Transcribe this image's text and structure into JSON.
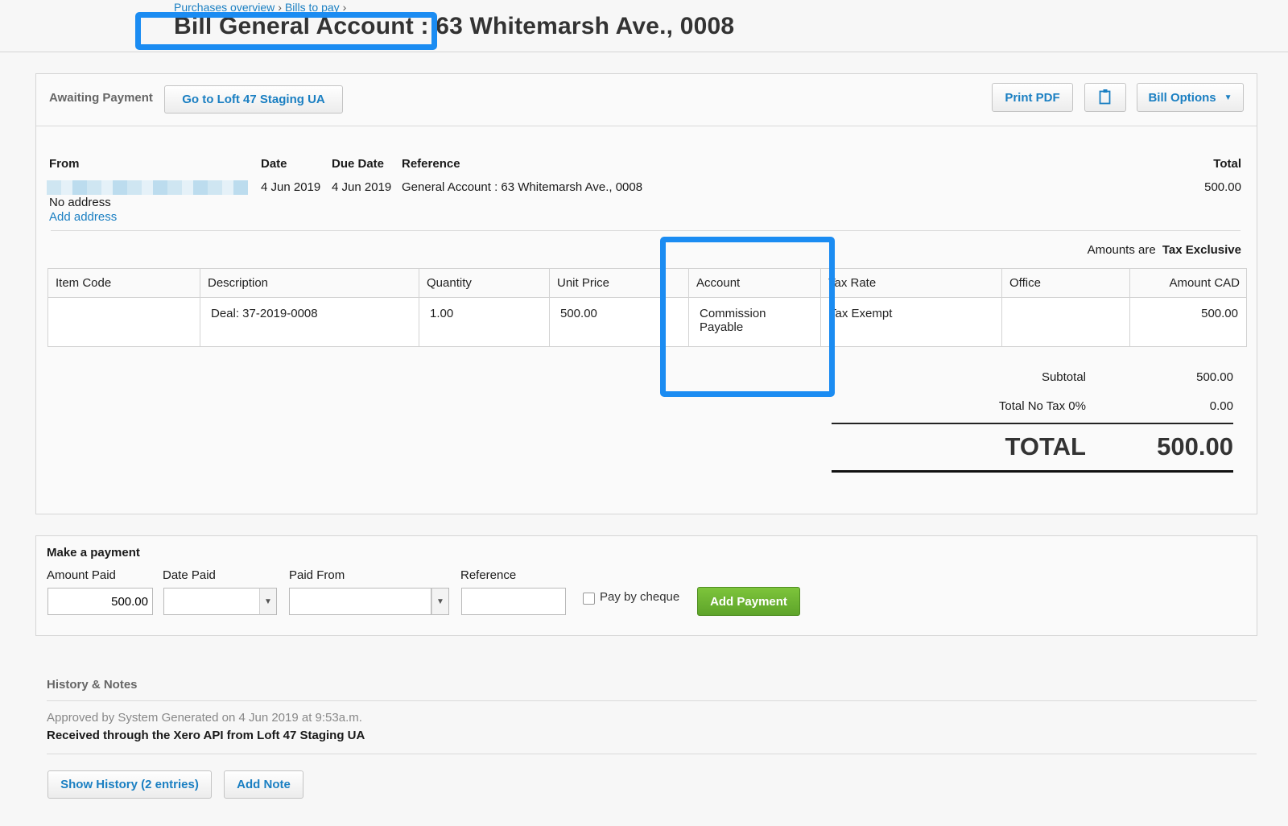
{
  "breadcrumb": {
    "items": [
      "Purchases overview",
      "Bills to pay"
    ],
    "sep": "›"
  },
  "title": "Bill General Account : 63 Whitemarsh Ave., 0008",
  "status": "Awaiting Payment",
  "buttons": {
    "goto": "Go to Loft 47 Staging UA",
    "print_pdf": "Print PDF",
    "bill_options": "Bill Options",
    "add_payment": "Add Payment",
    "show_history": "Show History (2 entries)",
    "add_note": "Add Note"
  },
  "summary": {
    "from_label": "From",
    "no_address": "No address",
    "add_address": "Add address",
    "date_label": "Date",
    "date_value": "4 Jun 2019",
    "due_label": "Due Date",
    "due_value": "4 Jun 2019",
    "ref_label": "Reference",
    "ref_value": "General Account : 63 Whitemarsh Ave., 0008",
    "total_label": "Total",
    "total_value": "500.00"
  },
  "amounts_note": {
    "prefix": "Amounts are",
    "mode": "Tax Exclusive"
  },
  "table": {
    "headers": [
      "Item Code",
      "Description",
      "Quantity",
      "Unit Price",
      "",
      "Account",
      "Tax Rate",
      "Office",
      "Amount CAD"
    ],
    "rows": [
      [
        "",
        "Deal: 37-2019-0008",
        "1.00",
        "500.00",
        "",
        "Commission Payable",
        "Tax Exempt",
        "",
        "500.00"
      ]
    ]
  },
  "totals": {
    "subtotal_label": "Subtotal",
    "subtotal_value": "500.00",
    "tax_label": "Total No Tax 0%",
    "tax_value": "0.00",
    "total_label": "TOTAL",
    "total_value": "500.00"
  },
  "payment": {
    "title": "Make a payment",
    "amount_label": "Amount Paid",
    "amount_value": "500.00",
    "date_label": "Date Paid",
    "from_label": "Paid From",
    "ref_label": "Reference",
    "cheque_label": "Pay by cheque"
  },
  "history": {
    "title": "History & Notes",
    "line1": "Approved by System Generated on 4 Jun 2019 at 9:53a.m.",
    "line2": "Received through the Xero API from Loft 47 Staging UA"
  },
  "colors": {
    "highlight": "#1b8cf2",
    "link": "#1a7fc2",
    "add_payment": "#6db232"
  }
}
